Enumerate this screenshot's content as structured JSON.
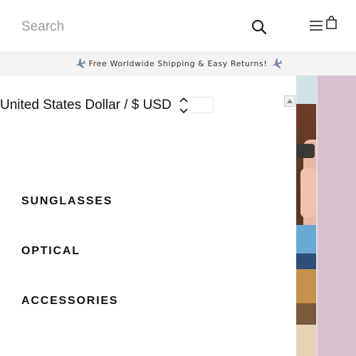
{
  "header": {
    "search_placeholder": "Search",
    "icons": {
      "search": "search-icon",
      "menu": "hamburger-menu-icon",
      "bag": "shopping-bag-icon"
    }
  },
  "announcement": {
    "text": "Free Worldwide Shipping & Easy Returns!",
    "icon": "airplane-icon"
  },
  "drawer": {
    "currency": {
      "selected": "United States Dollar / $ USD",
      "icon": "up-down-chevron-icon"
    },
    "nav_items": [
      {
        "label": "SUNGLASSES"
      },
      {
        "label": "OPTICAL"
      },
      {
        "label": "ACCESSORIES"
      }
    ]
  },
  "colors": {
    "announcement_bg": "#f3f3f3",
    "hero_bg": "#d8c1cf",
    "text": "#111111",
    "placeholder": "#9a9a9a"
  }
}
